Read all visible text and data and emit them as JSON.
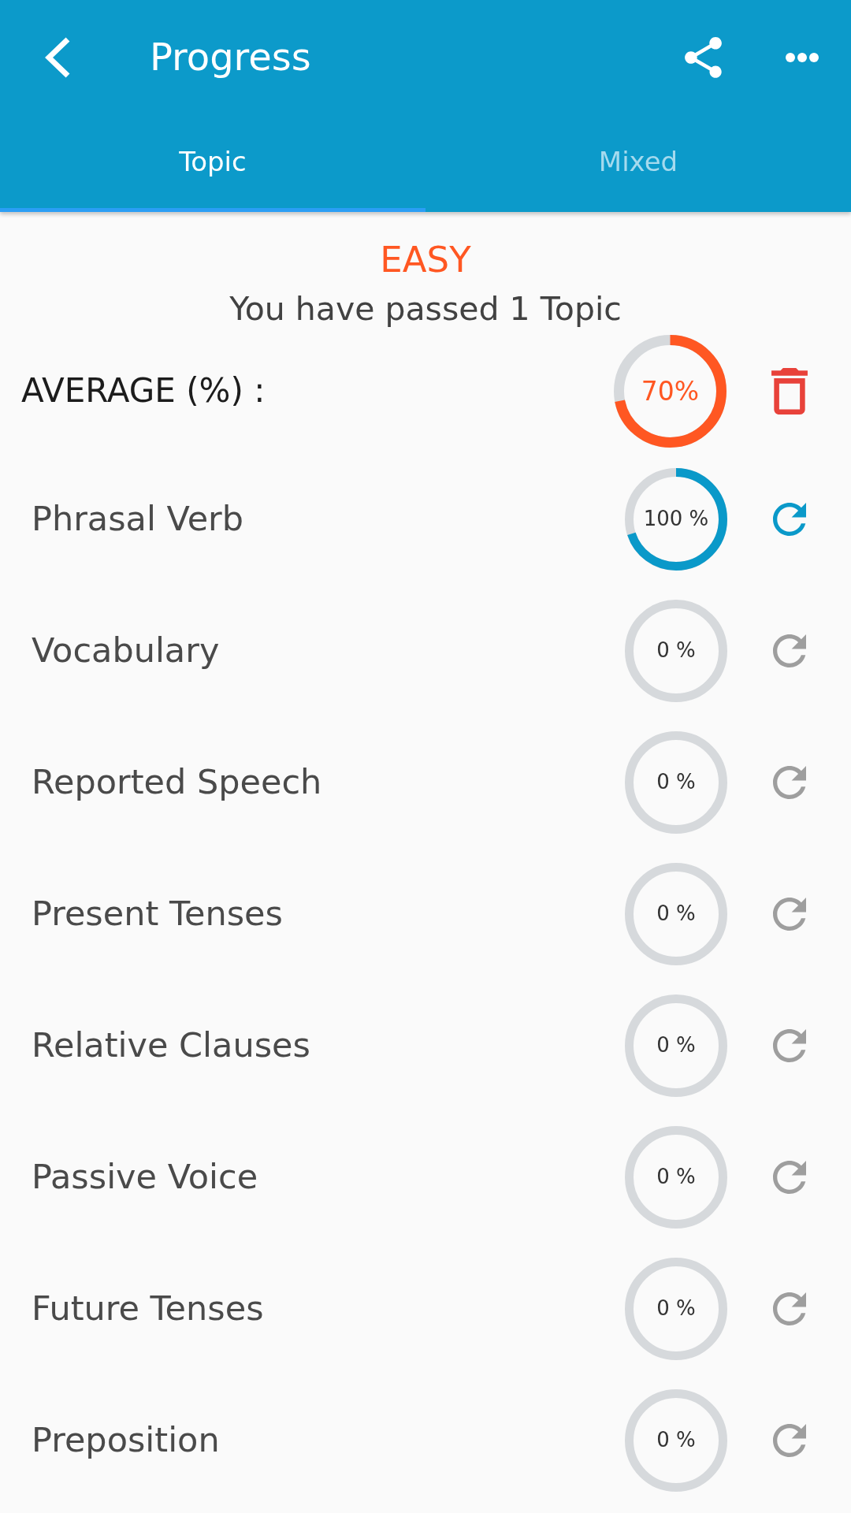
{
  "app_bar": {
    "title": "Progress"
  },
  "tabs": [
    {
      "label": "Topic",
      "selected": true
    },
    {
      "label": "Mixed",
      "selected": false
    }
  ],
  "summary": {
    "difficulty": "EASY",
    "message": "You have passed 1 Topic"
  },
  "average": {
    "label": "AVERAGE (%) :",
    "reading": "70%",
    "level": 0.72
  },
  "topics": [
    {
      "name": "Phrasal Verb",
      "reading": "100 %",
      "level": 0.7,
      "passed": true
    },
    {
      "name": "Vocabulary",
      "reading": "0 %",
      "level": 0,
      "passed": false
    },
    {
      "name": "Reported Speech",
      "reading": "0 %",
      "level": 0,
      "passed": false
    },
    {
      "name": "Present Tenses",
      "reading": "0 %",
      "level": 0,
      "passed": false
    },
    {
      "name": "Relative Clauses",
      "reading": "0 %",
      "level": 0,
      "passed": false
    },
    {
      "name": "Passive Voice",
      "reading": "0 %",
      "level": 0,
      "passed": false
    },
    {
      "name": "Future Tenses",
      "reading": "0 %",
      "level": 0,
      "passed": false
    },
    {
      "name": "Preposition",
      "reading": "0 %",
      "level": 0,
      "passed": false
    }
  ]
}
